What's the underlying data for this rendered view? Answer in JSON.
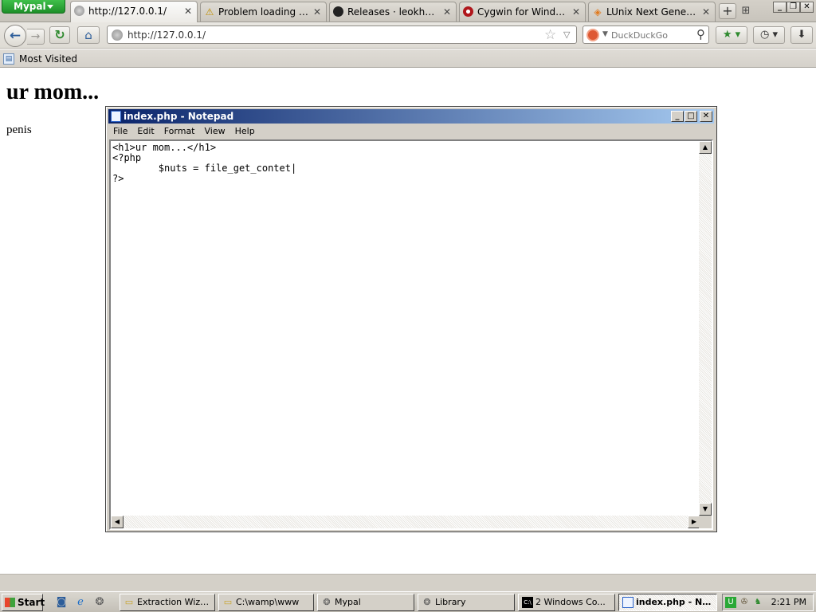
{
  "browser": {
    "app_menu": "Mypal",
    "tabs": [
      {
        "label": "http://127.0.0.1/",
        "icon": "globe-icon",
        "active": true
      },
      {
        "label": "Problem loading page",
        "icon": "warning-icon",
        "active": false
      },
      {
        "label": "Releases · leokhoa/lar...",
        "icon": "github-icon",
        "active": false
      },
      {
        "label": "Cygwin for Windows X...",
        "icon": "cygwin-icon",
        "active": false
      },
      {
        "label": "LUnix Next Generation...",
        "icon": "diamond-icon",
        "active": false
      }
    ],
    "url": "http://127.0.0.1/",
    "search": {
      "engine": "DuckDuckGo",
      "placeholder": "DuckDuckGo"
    },
    "bookmarks": [
      {
        "label": "Most Visited"
      }
    ]
  },
  "page": {
    "heading": "ur mom...",
    "body": "penis"
  },
  "notepad": {
    "title": "index.php - Notepad",
    "menu": [
      "File",
      "Edit",
      "Format",
      "View",
      "Help"
    ],
    "content": "<h1>ur mom...</h1>\n<?php\n\t$nuts = file_get_contet|\n?>"
  },
  "taskbar": {
    "start_label": "Start",
    "tasks": [
      {
        "label": "Extraction Wizard",
        "icon": "folder-icon",
        "active": false
      },
      {
        "label": "C:\\wamp\\www",
        "icon": "folder-icon",
        "active": false
      },
      {
        "label": "Mypal",
        "icon": "mypal-icon",
        "active": false
      },
      {
        "label": "Library",
        "icon": "mypal-icon",
        "active": false
      },
      {
        "label": "2 Windows Co...",
        "icon": "console-icon",
        "active": false
      },
      {
        "label": "index.php - Not...",
        "icon": "notepad-icon",
        "active": true
      }
    ],
    "clock": "2:21 PM"
  },
  "colors": {
    "title_bar_start": "#0a246a",
    "title_bar_end": "#a6caf0",
    "app_menu": "#2aa836"
  }
}
